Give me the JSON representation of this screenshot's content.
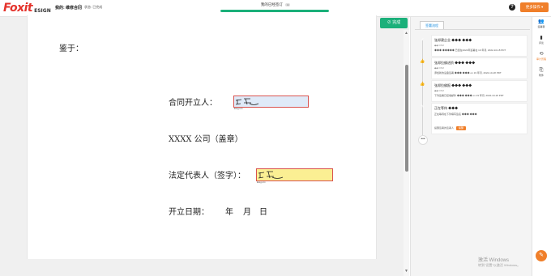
{
  "brand": {
    "name": "Foxit",
    "product": "ESIGN"
  },
  "header": {
    "doc_title": "我的: 维修合同",
    "doc_status": "状态: 已完成",
    "progress_label": "我的已经签订",
    "progress_count": "1",
    "progress": 1.0,
    "help_icon": "question-icon",
    "more_button": "更多操作"
  },
  "toolbar": {
    "complete_button": "完成"
  },
  "document": {
    "lines": [
      "鉴于：",
      "合同开立人：",
      "XXXX 公司（盖章）",
      "法定代表人（签字）：",
      "开立日期：",
      "年",
      "月",
      "日"
    ],
    "signature_caption": "Esign.fx",
    "signature_colors": {
      "first_bg": "#dfeaf8",
      "second_bg": "#fbef93",
      "border": "#d9534f"
    }
  },
  "panel": {
    "tab": "签署流程",
    "timeline": [
      {
        "icon": "check-icon",
        "color": "#1bb07a",
        "title": "张邦建企业 ◆◆◆ ◆◆◆",
        "sub": "◆◆ FXM",
        "desc": "◆◆◆ ◆◆◆◆◆ 已经在2022年签署在 19 年月, 2022-10-18 PDT"
      },
      {
        "icon": "thumbs-up-icon",
        "color": "#1bb07a",
        "title": "张邦拉佛进阶 ◆◆◆ ◆◆◆",
        "sub": "◆◆ FXM",
        "desc": "添加新的设备签署 ◆◆◆ ◆◆◆ on 19 年月, 2022-10-18 PDT"
      },
      {
        "icon": "thumbs-up-icon",
        "color": "#1bb07a",
        "title": "张邦拉佛报 ◆◆◆ ◆◆◆",
        "sub": "◆◆ FXM",
        "desc": "下列签署已接收邮件 ◆◆◆ ◆◆◆ on 19 年月, 2022-10-18 PDT"
      },
      {
        "icon": "pencil-icon",
        "color": "#f2c72c",
        "title": "正在等待 ◆◆◆",
        "sub": "",
        "desc": "正在等待在下列填写签名 ◆◆◆ ◆◆◆",
        "remind_text": "提醒签署的签署人",
        "remind_button": "提醒"
      }
    ],
    "more": "•••"
  },
  "sidenav": [
    {
      "icon": "users-icon",
      "label": "签署者"
    },
    {
      "icon": "comment-icon",
      "label": "评论"
    },
    {
      "icon": "history-icon",
      "label": "审计历程",
      "active": true
    },
    {
      "icon": "attachment-icon",
      "label": "附件"
    }
  ],
  "fab_icon": "chat-icon",
  "watermark": {
    "title": "激活 Windows",
    "sub": "转到\"设置\"以激活 Windows。"
  }
}
